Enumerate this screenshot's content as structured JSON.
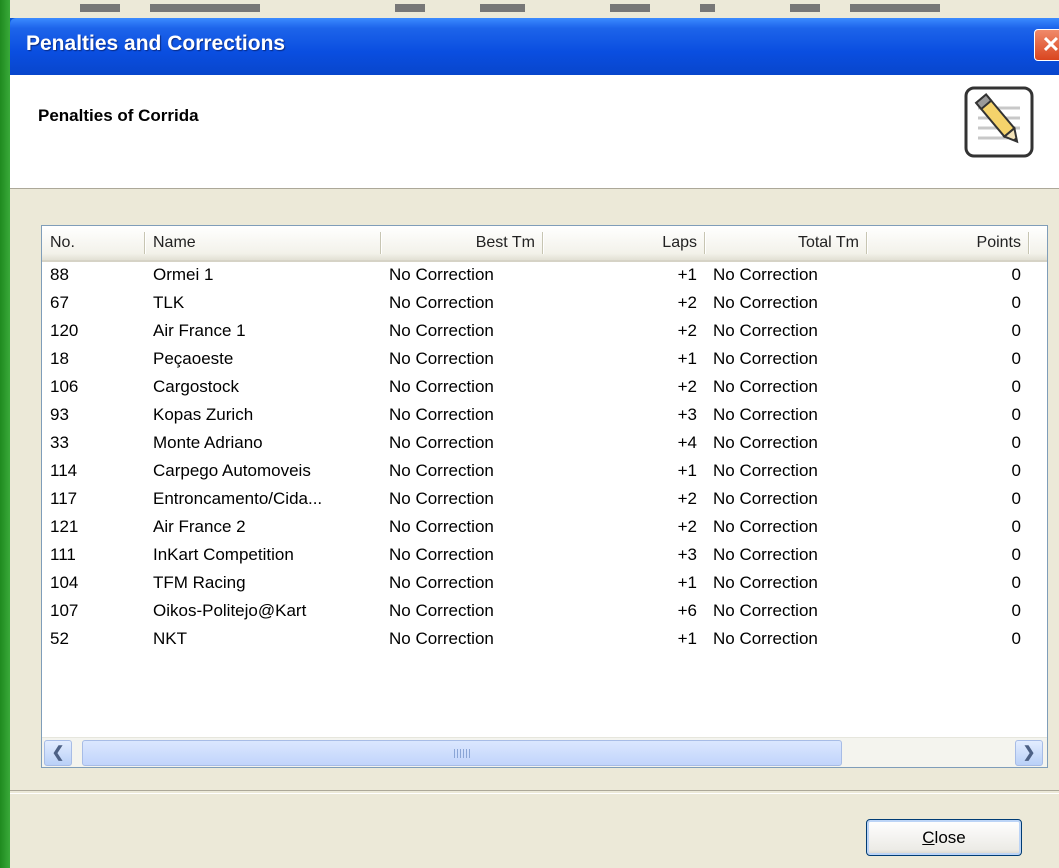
{
  "window": {
    "title": "Penalties and Corrections",
    "close_glyph": "✕"
  },
  "header": {
    "title": "Penalties of Corrida",
    "icon": "edit-document-icon"
  },
  "table": {
    "columns": [
      "No.",
      "Name",
      "Best Tm",
      "Laps",
      "Total Tm",
      "Points"
    ],
    "rows": [
      {
        "no": "88",
        "name": "Ormei 1",
        "best": "No Correction",
        "laps": "+1",
        "total": "No Correction",
        "points": "0"
      },
      {
        "no": "67",
        "name": "TLK",
        "best": "No Correction",
        "laps": "+2",
        "total": "No Correction",
        "points": "0"
      },
      {
        "no": "120",
        "name": "Air France 1",
        "best": "No Correction",
        "laps": "+2",
        "total": "No Correction",
        "points": "0"
      },
      {
        "no": "18",
        "name": "Peçaoeste",
        "best": "No Correction",
        "laps": "+1",
        "total": "No Correction",
        "points": "0"
      },
      {
        "no": "106",
        "name": "Cargostock",
        "best": "No Correction",
        "laps": "+2",
        "total": "No Correction",
        "points": "0"
      },
      {
        "no": "93",
        "name": "Kopas Zurich",
        "best": "No Correction",
        "laps": "+3",
        "total": "No Correction",
        "points": "0"
      },
      {
        "no": "33",
        "name": "Monte Adriano",
        "best": "No Correction",
        "laps": "+4",
        "total": "No Correction",
        "points": "0"
      },
      {
        "no": "114",
        "name": "Carpego Automoveis",
        "best": "No Correction",
        "laps": "+1",
        "total": "No Correction",
        "points": "0"
      },
      {
        "no": "117",
        "name": "Entroncamento/Cida...",
        "best": "No Correction",
        "laps": "+2",
        "total": "No Correction",
        "points": "0"
      },
      {
        "no": "121",
        "name": "Air France 2",
        "best": "No Correction",
        "laps": "+2",
        "total": "No Correction",
        "points": "0"
      },
      {
        "no": "111",
        "name": "InKart Competition",
        "best": "No Correction",
        "laps": "+3",
        "total": "No Correction",
        "points": "0"
      },
      {
        "no": "104",
        "name": "TFM Racing",
        "best": "No Correction",
        "laps": "+1",
        "total": "No Correction",
        "points": "0"
      },
      {
        "no": "107",
        "name": "Oikos-Politejo@Kart",
        "best": "No Correction",
        "laps": "+6",
        "total": "No Correction",
        "points": "0"
      },
      {
        "no": "52",
        "name": "NKT",
        "best": "No Correction",
        "laps": "+1",
        "total": "No Correction",
        "points": "0"
      }
    ]
  },
  "scrollbar": {
    "left_glyph": "❮",
    "right_glyph": "❯"
  },
  "footer": {
    "close_mnemonic": "C",
    "close_rest": "lose"
  },
  "colors": {
    "titlebar": "#0a4ee0",
    "dialog_bg": "#ece9d8",
    "close_x": "#d9451f",
    "list_border": "#7f9db9"
  }
}
